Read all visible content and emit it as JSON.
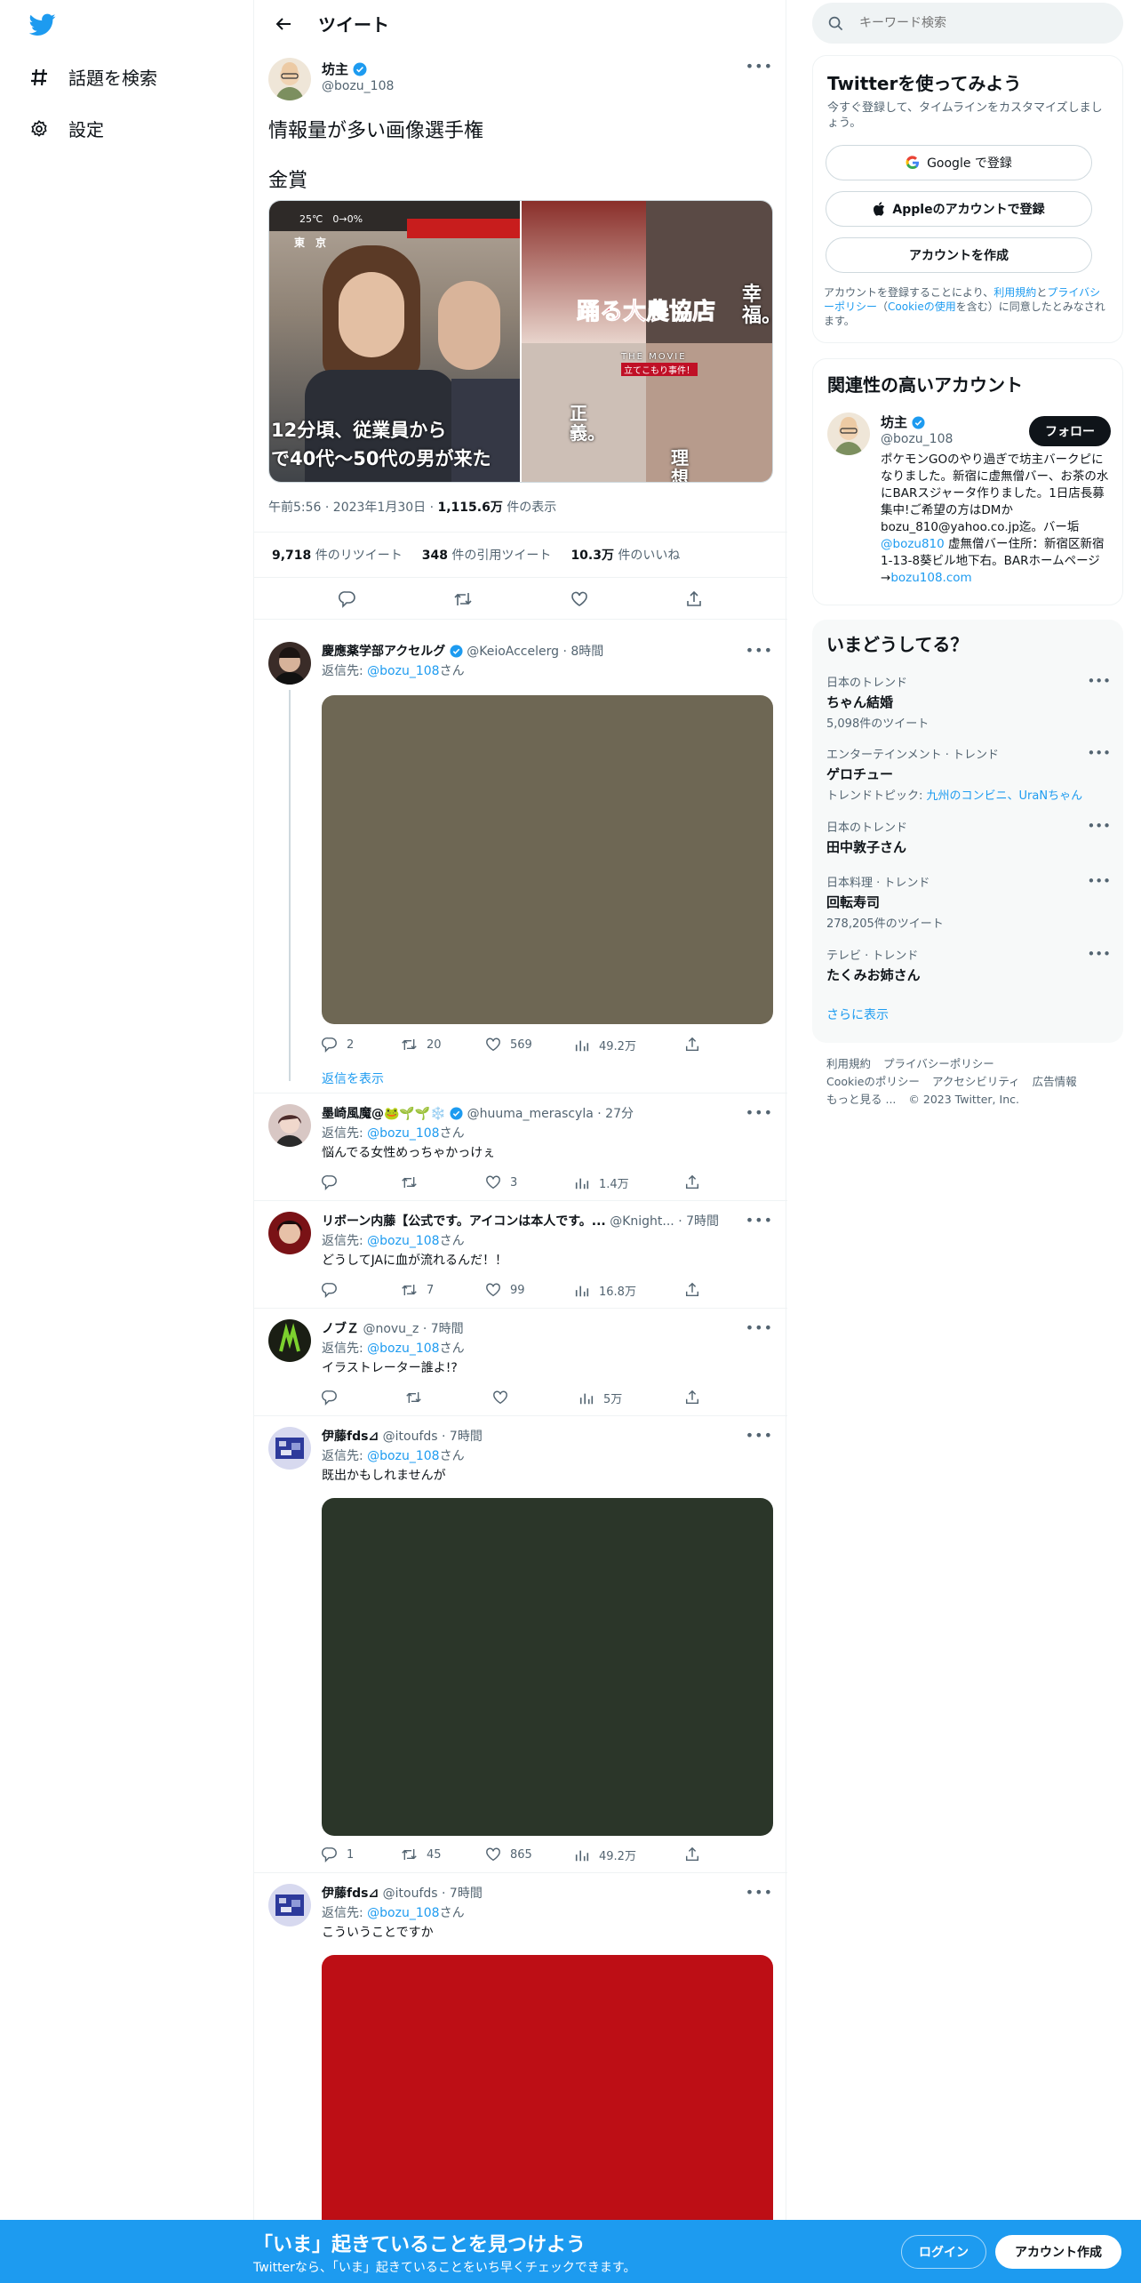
{
  "nav": {
    "explore": "話題を検索",
    "settings": "設定"
  },
  "header": {
    "title": "ツイート"
  },
  "tweet": {
    "name": "坊主",
    "handle": "@bozu_108",
    "text_line1": "情報量が多い画像選手権",
    "text_line2": "金賞",
    "img_left": {
      "temp": "25℃　0→0%",
      "city": "東　京",
      "caption_line1": "12分頃、従業員から",
      "caption_line2": "で40代〜50代の男が来た"
    },
    "img_right": {
      "title": "踊る大農協店",
      "subtitle": "THE MOVIE",
      "tag": "立てこもり事件！",
      "kou": "幸福。",
      "sei": "正義。",
      "riso": "理想"
    },
    "time": "午前5:56 · 2023年1月30日 · ",
    "views_num": "1,115.6万",
    "views_label": " 件の表示",
    "retweets_num": "9,718",
    "retweets_label": " 件のリツイート",
    "quotes_num": "348",
    "quotes_label": " 件の引用ツイート",
    "likes_num": "10.3万",
    "likes_label": " 件のいいね"
  },
  "replies": [
    {
      "name": "慶應薬学部アクセルグ",
      "handle": "@KeioAccelerg",
      "time": "· 8時間",
      "to_prefix": "返信先: ",
      "to": "@bozu_108",
      "to_suffix": "さん",
      "text": "",
      "replies": "2",
      "retweets": "20",
      "likes": "569",
      "views": "49.2万",
      "media_color": "#6e6754",
      "show_replies": "返信を表示"
    },
    {
      "name": "墨崎風魔@🐸🌱🌱❄️",
      "handle": "@huuma_merascyla",
      "time": "· 27分",
      "to_prefix": "返信先: ",
      "to": "@bozu_108",
      "to_suffix": "さん",
      "text": "悩んでる女性めっちゃかっけぇ",
      "replies": "",
      "retweets": "",
      "likes": "3",
      "views": "1.4万"
    },
    {
      "name": "リボーン内藤【公式です。アイコンは本人です。...",
      "handle": "@Knight...",
      "time": "· 7時間",
      "to_prefix": "返信先: ",
      "to": "@bozu_108",
      "to_suffix": "さん",
      "text": "どうしてJAに血が流れるんだ！！",
      "replies": "",
      "retweets": "7",
      "likes": "99",
      "views": "16.8万"
    },
    {
      "name": "ノブＺ",
      "handle": "@novu_z",
      "time": "· 7時間",
      "to_prefix": "返信先: ",
      "to": "@bozu_108",
      "to_suffix": "さん",
      "text": "イラストレーター誰よ!?",
      "replies": "",
      "retweets": "",
      "likes": "",
      "views": "5万"
    },
    {
      "name": "伊藤fds⊿",
      "handle": "@itoufds",
      "time": "· 7時間",
      "to_prefix": "返信先: ",
      "to": "@bozu_108",
      "to_suffix": "さん",
      "text": "既出かもしれませんが",
      "replies": "1",
      "retweets": "45",
      "likes": "865",
      "views": "49.2万",
      "media_color": "#2b3629"
    },
    {
      "name": "伊藤fds⊿",
      "handle": "@itoufds",
      "time": "· 7時間",
      "to_prefix": "返信先: ",
      "to": "@bozu_108",
      "to_suffix": "さん",
      "text": "こういうことですか",
      "media_color": "#bd0e15"
    }
  ],
  "search": {
    "placeholder": "キーワード検索"
  },
  "signup": {
    "title": "Twitterを使ってみよう",
    "subtitle": "今すぐ登録して、タイムラインをカスタマイズしましょう。",
    "google": "Google で登録",
    "apple": "Appleのアカウントで登録",
    "create": "アカウントを作成",
    "legal_1": "アカウントを登録することにより、",
    "legal_terms": "利用規約",
    "legal_2": "と",
    "legal_privacy": "プライバシーポリシー",
    "legal_3": "（",
    "legal_cookie": "Cookieの使用",
    "legal_4": "を含む）に同意したとみなされます。"
  },
  "related": {
    "title": "関連性の高いアカウント",
    "name": "坊主",
    "handle": "@bozu_108",
    "follow": "フォロー",
    "bio_1": "ポケモンGOのやり過ぎで坊主バークピになりました。新宿に虚無僧バー、お茶の水にBARスジャータ作りました。1日店長募集中!ご希望の方はDMかbozu_810@yahoo.co.jp迄。バー垢",
    "bio_link1": "@bozu810",
    "bio_2": " 虚無僧バー住所：新宿区新宿1-13-8葵ビル地下右。BARホームページ→",
    "bio_link2": "bozu108.com"
  },
  "trends": {
    "title": "いまどうしてる？",
    "items": [
      {
        "category": "日本のトレンド",
        "name": "ちゃん結婚",
        "sub": "5,098件のツイート"
      },
      {
        "category": "エンターテインメント · トレンド",
        "name": "ゲロチュー",
        "sub_prefix": "トレンドトピック: ",
        "sub_link": "九州のコンビニ、UraNちゃん"
      },
      {
        "category": "日本のトレンド",
        "name": "田中敦子さん"
      },
      {
        "category": "日本料理 · トレンド",
        "name": "回転寿司",
        "sub": "278,205件のツイート"
      },
      {
        "category": "テレビ · トレンド",
        "name": "たくみお姉さん"
      }
    ],
    "more": "さらに表示"
  },
  "footer": {
    "terms": "利用規約",
    "privacy": "プライバシーポリシー",
    "cookie": "Cookieのポリシー",
    "access": "アクセシビリティ",
    "ads": "広告情報",
    "more": "もっと見る ...",
    "copy": "© 2023 Twitter, Inc."
  },
  "banner": {
    "title": "「いま」起きていることを見つけよう",
    "subtitle": "Twitterなら、「いま」起きていることをいち早くチェックできます。",
    "login": "ログイン",
    "signup": "アカウント作成"
  },
  "colors": {
    "accent": "#1d9bf0",
    "text": "#0f1419",
    "muted": "#536471"
  }
}
